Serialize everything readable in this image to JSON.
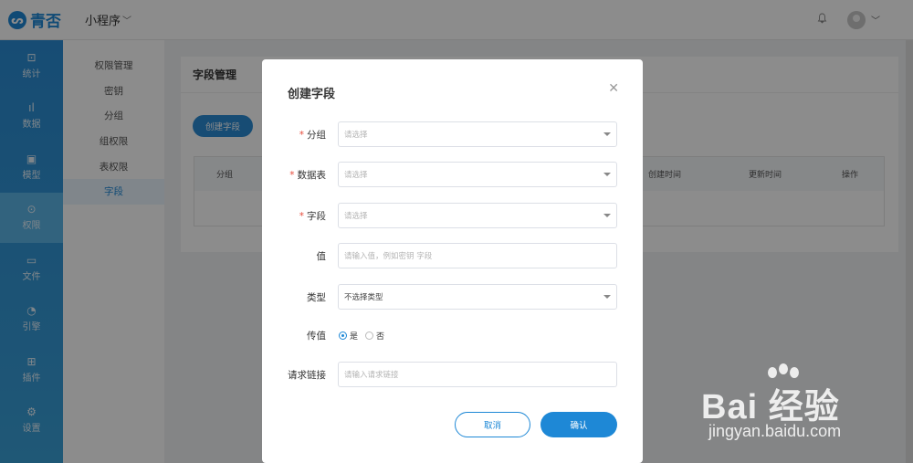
{
  "app": {
    "logo_glyph": "ᔕ",
    "logo_text": "青否",
    "switcher_label": "小程序"
  },
  "leftnav": [
    {
      "label": "统计",
      "icon": "presentation-icon",
      "glyph": "⊡"
    },
    {
      "label": "数据",
      "icon": "bar-chart-icon",
      "glyph": "ıl"
    },
    {
      "label": "模型",
      "icon": "model-icon",
      "glyph": "▣"
    },
    {
      "label": "权限",
      "icon": "location-pin-icon",
      "glyph": "⊙",
      "active": true
    },
    {
      "label": "文件",
      "icon": "folder-icon",
      "glyph": "▭"
    },
    {
      "label": "引擎",
      "icon": "gauge-icon",
      "glyph": "◔"
    },
    {
      "label": "插件",
      "icon": "plugin-icon",
      "glyph": "⊞"
    },
    {
      "label": "设置",
      "icon": "gear-icon",
      "glyph": "⚙"
    }
  ],
  "subnav": [
    {
      "label": "权限管理"
    },
    {
      "label": "密钥"
    },
    {
      "label": "分组"
    },
    {
      "label": "组权限"
    },
    {
      "label": "表权限"
    },
    {
      "label": "字段",
      "active": true
    }
  ],
  "panel": {
    "title": "字段管理",
    "create_button": "创建字段",
    "columns": [
      "分组",
      "创建时间",
      "更新时间",
      "操作"
    ]
  },
  "modal": {
    "title": "创建字段",
    "close_glyph": "✕",
    "fields": {
      "group": {
        "label": "分组",
        "required": true,
        "placeholder": "请选择"
      },
      "table": {
        "label": "数据表",
        "required": true,
        "placeholder": "请选择"
      },
      "field": {
        "label": "字段",
        "required": true,
        "placeholder": "请选择"
      },
      "value": {
        "label": "值",
        "placeholder": "请输入值，例如密钥 字段"
      },
      "type": {
        "label": "类型",
        "value": "不选择类型"
      },
      "pass_value": {
        "label": "传值",
        "options": [
          "是",
          "否"
        ],
        "selected": "是"
      },
      "request_link": {
        "label": "请求链接",
        "placeholder": "请输入请求链接"
      }
    },
    "required_mark": "*",
    "cancel_label": "取消",
    "confirm_label": "确认"
  },
  "watermark": {
    "line1": "Bai 经验",
    "line2": "jingyan.baidu.com"
  },
  "colors": {
    "brand": "#1e88d6",
    "nav_gradient_top": "#2a8bd3",
    "required": "#e74c3c"
  }
}
